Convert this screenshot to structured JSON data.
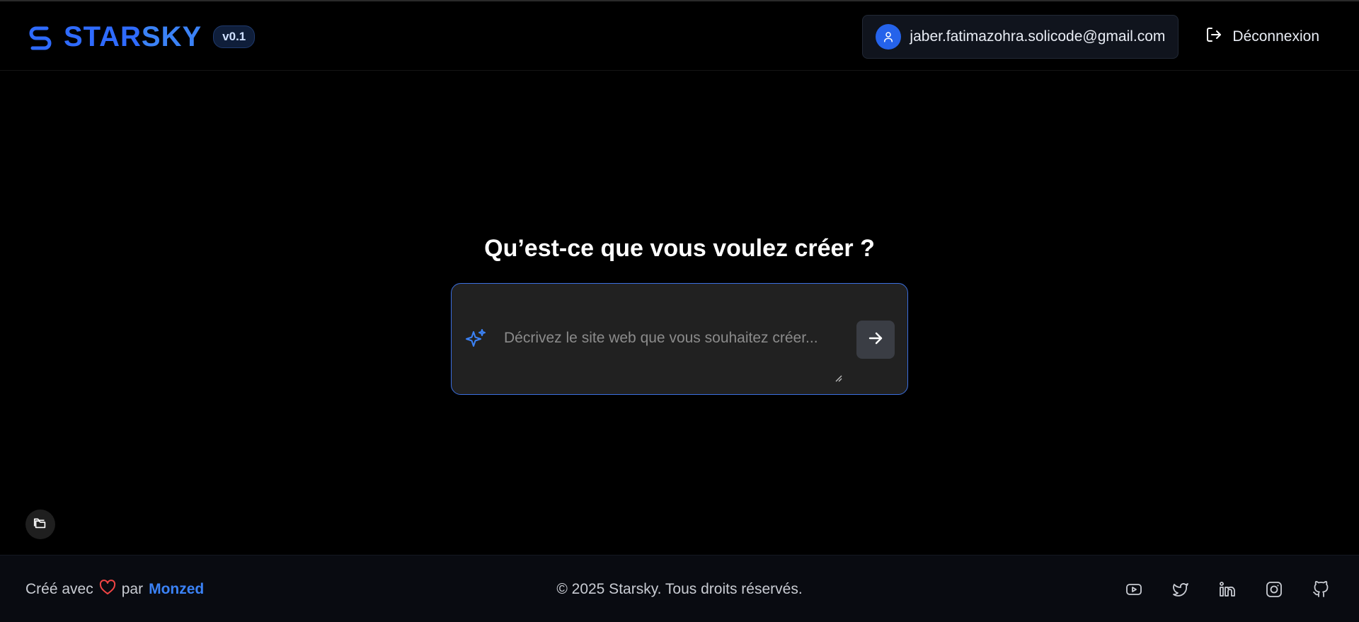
{
  "header": {
    "brand_part1": "STAR",
    "brand_part2": "SKY",
    "version": "v0.1",
    "user_email": "jaber.fatimazohra.solicode@gmail.com",
    "logout_label": "Déconnexion"
  },
  "main": {
    "title": "Qu’est-ce que vous voulez créer ?",
    "prompt_placeholder": "Décrivez le site web que vous souhaitez créer...",
    "prompt_value": ""
  },
  "footer": {
    "made_with_prefix": "Créé avec",
    "made_with_by": "par",
    "author": "Monzed",
    "copyright": "© 2025 Starsky. Tous droits réservés."
  },
  "icons": {
    "logo": "starsky-logo-icon",
    "user": "user-icon",
    "logout": "logout-icon",
    "sparkle": "sparkles-icon",
    "send": "arrow-right-icon",
    "folder": "folder-icon",
    "heart": "heart-icon",
    "socials": [
      "youtube-icon",
      "twitter-icon",
      "linkedin-icon",
      "instagram-icon",
      "github-icon"
    ]
  },
  "colors": {
    "accent": "#3b82f6",
    "brand": "#2f6bff",
    "background": "#000000",
    "heart": "#ef4444"
  }
}
